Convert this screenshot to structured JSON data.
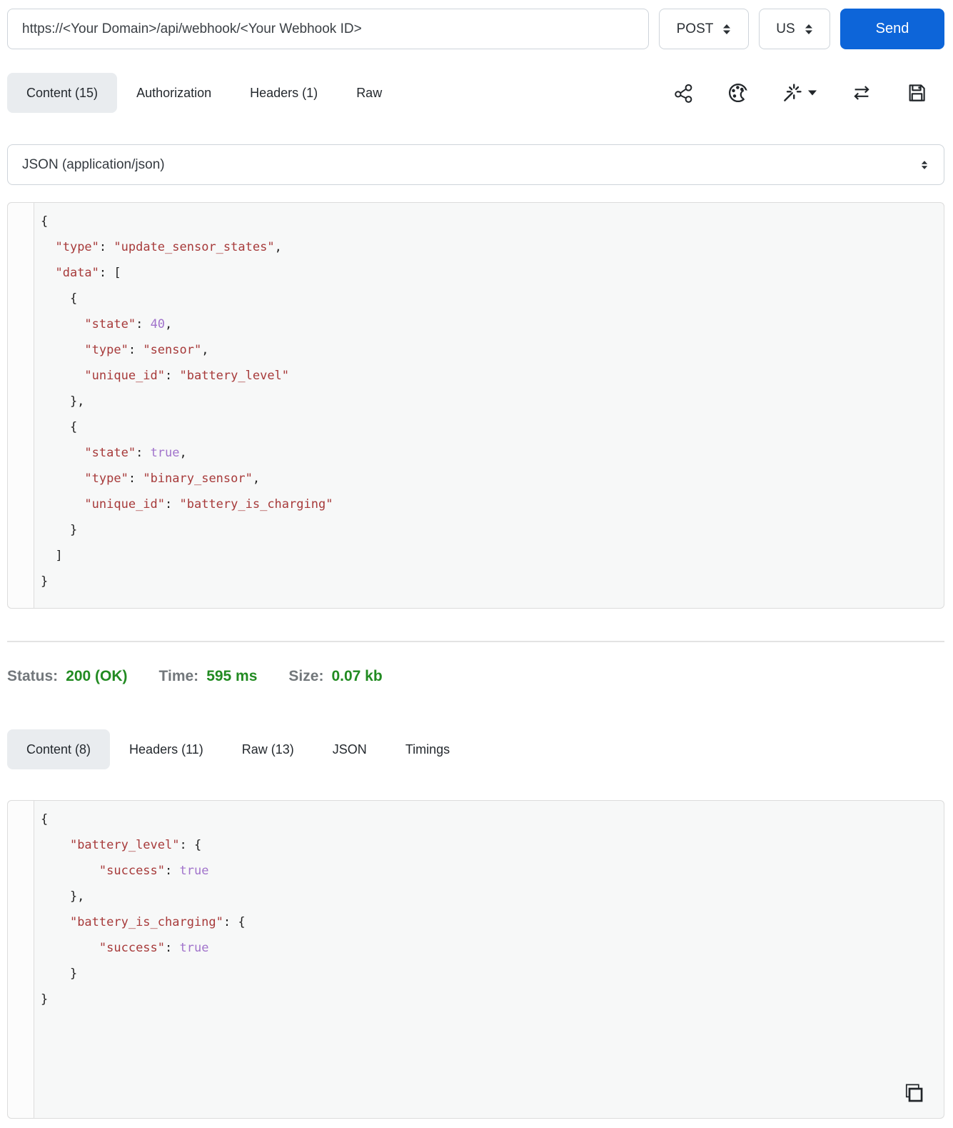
{
  "request": {
    "url": "https://<Your Domain>/api/webhook/<Your Webhook ID>",
    "method": "POST",
    "locale": "US",
    "send_label": "Send",
    "tabs": [
      {
        "label": "Content (15)",
        "active": true
      },
      {
        "label": "Authorization",
        "active": false
      },
      {
        "label": "Headers (1)",
        "active": false
      },
      {
        "label": "Raw",
        "active": false
      }
    ],
    "content_type": "JSON (application/json)",
    "body_lines": [
      [
        [
          "p",
          "{"
        ]
      ],
      [
        [
          "p",
          "  "
        ],
        [
          "r",
          "\"type\""
        ],
        [
          "p",
          ": "
        ],
        [
          "r",
          "\"update_sensor_states\""
        ],
        [
          "p",
          ","
        ]
      ],
      [
        [
          "p",
          "  "
        ],
        [
          "r",
          "\"data\""
        ],
        [
          "p",
          ": ["
        ]
      ],
      [
        [
          "p",
          "    {"
        ]
      ],
      [
        [
          "p",
          "      "
        ],
        [
          "r",
          "\"state\""
        ],
        [
          "p",
          ": "
        ],
        [
          "v",
          "40"
        ],
        [
          "p",
          ","
        ]
      ],
      [
        [
          "p",
          "      "
        ],
        [
          "r",
          "\"type\""
        ],
        [
          "p",
          ": "
        ],
        [
          "r",
          "\"sensor\""
        ],
        [
          "p",
          ","
        ]
      ],
      [
        [
          "p",
          "      "
        ],
        [
          "r",
          "\"unique_id\""
        ],
        [
          "p",
          ": "
        ],
        [
          "r",
          "\"battery_level\""
        ]
      ],
      [
        [
          "p",
          "    },"
        ]
      ],
      [
        [
          "p",
          "    {"
        ]
      ],
      [
        [
          "p",
          "      "
        ],
        [
          "r",
          "\"state\""
        ],
        [
          "p",
          ": "
        ],
        [
          "v",
          "true"
        ],
        [
          "p",
          ","
        ]
      ],
      [
        [
          "p",
          "      "
        ],
        [
          "r",
          "\"type\""
        ],
        [
          "p",
          ": "
        ],
        [
          "r",
          "\"binary_sensor\""
        ],
        [
          "p",
          ","
        ]
      ],
      [
        [
          "p",
          "      "
        ],
        [
          "r",
          "\"unique_id\""
        ],
        [
          "p",
          ": "
        ],
        [
          "r",
          "\"battery_is_charging\""
        ]
      ],
      [
        [
          "p",
          "    }"
        ]
      ],
      [
        [
          "p",
          "  ]"
        ]
      ],
      [
        [
          "p",
          "}"
        ]
      ]
    ]
  },
  "response": {
    "status": {
      "label": "Status:",
      "value": "200 (OK)"
    },
    "time": {
      "label": "Time:",
      "value": "595 ms"
    },
    "size": {
      "label": "Size:",
      "value": "0.07 kb"
    },
    "tabs": [
      {
        "label": "Content (8)",
        "active": true
      },
      {
        "label": "Headers (11)",
        "active": false
      },
      {
        "label": "Raw (13)",
        "active": false
      },
      {
        "label": "JSON",
        "active": false
      },
      {
        "label": "Timings",
        "active": false
      }
    ],
    "body_lines": [
      [
        [
          "p",
          "{"
        ]
      ],
      [
        [
          "p",
          "    "
        ],
        [
          "r",
          "\"battery_level\""
        ],
        [
          "p",
          ": {"
        ]
      ],
      [
        [
          "p",
          "        "
        ],
        [
          "r",
          "\"success\""
        ],
        [
          "p",
          ": "
        ],
        [
          "v",
          "true"
        ]
      ],
      [
        [
          "p",
          "    },"
        ]
      ],
      [
        [
          "p",
          "    "
        ],
        [
          "r",
          "\"battery_is_charging\""
        ],
        [
          "p",
          ": {"
        ]
      ],
      [
        [
          "p",
          "        "
        ],
        [
          "r",
          "\"success\""
        ],
        [
          "p",
          ": "
        ],
        [
          "v",
          "true"
        ]
      ],
      [
        [
          "p",
          "    }"
        ]
      ],
      [
        [
          "p",
          "}"
        ]
      ]
    ]
  },
  "icons": {
    "toolbar": [
      "share-icon",
      "palette-icon",
      "magic-wand-icon",
      "swap-arrows-icon",
      "save-icon"
    ],
    "copy": "copy-icon",
    "select_arrows": "updown-arrows-icon"
  },
  "colors": {
    "accent_blue": "#0d65d9",
    "status_green": "#228b22",
    "code_string_red": "#a73a3a",
    "code_literal_purple": "#a173cb",
    "active_tab_gray": "#e9ecef"
  }
}
